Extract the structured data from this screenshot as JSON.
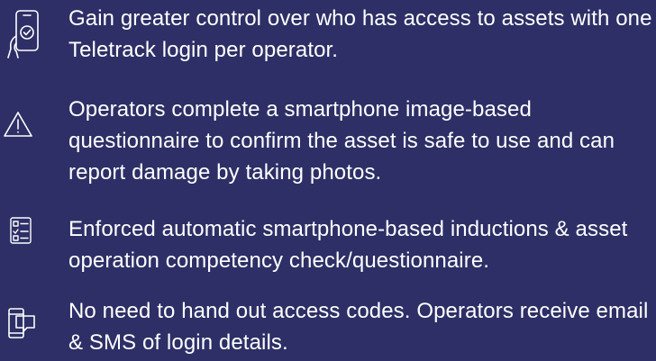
{
  "background_color": "#2d2f66",
  "text_color": "#ffffff",
  "features": [
    {
      "icon": "smartphone-hand-check-icon",
      "text": "Gain greater control over who has access to assets with one Teletrack login per operator."
    },
    {
      "icon": "warning-triangle-icon",
      "text": "Operators complete a smartphone image-based questionnaire to confirm the asset is safe to use and can report damage by taking photos."
    },
    {
      "icon": "checklist-icon",
      "text": "Enforced automatic smartphone-based inductions & asset operation competency check/questionnaire."
    },
    {
      "icon": "smartphone-message-icon",
      "text": "No need to hand out access codes. Operators receive email & SMS of login details."
    }
  ]
}
